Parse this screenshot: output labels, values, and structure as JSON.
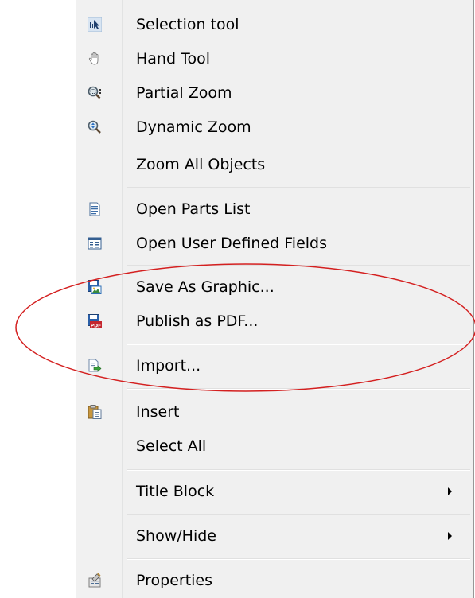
{
  "menu": {
    "items": [
      {
        "label": "Selection tool",
        "icon": "selection-arrow-icon"
      },
      {
        "label": "Hand Tool",
        "icon": "hand-icon"
      },
      {
        "label": "Partial Zoom",
        "icon": "partial-zoom-icon"
      },
      {
        "label": "Dynamic Zoom",
        "icon": "dynamic-zoom-icon"
      },
      {
        "label": "Zoom All Objects",
        "icon": ""
      },
      {
        "label": "Open Parts List",
        "icon": "parts-list-icon"
      },
      {
        "label": "Open User Defined Fields",
        "icon": "user-fields-icon"
      },
      {
        "label": "Save As Graphic...",
        "icon": "save-graphic-icon"
      },
      {
        "label": "Publish as PDF...",
        "icon": "pdf-icon"
      },
      {
        "label": "Import...",
        "icon": "import-icon"
      },
      {
        "label": "Insert",
        "icon": "paste-icon"
      },
      {
        "label": "Select All",
        "icon": ""
      },
      {
        "label": "Title Block",
        "icon": "",
        "submenu": true
      },
      {
        "label": "Show/Hide",
        "icon": "",
        "submenu": true
      },
      {
        "label": "Properties",
        "icon": "properties-icon"
      }
    ]
  },
  "annotation": {
    "color": "#d42020",
    "shape": "ellipse"
  }
}
